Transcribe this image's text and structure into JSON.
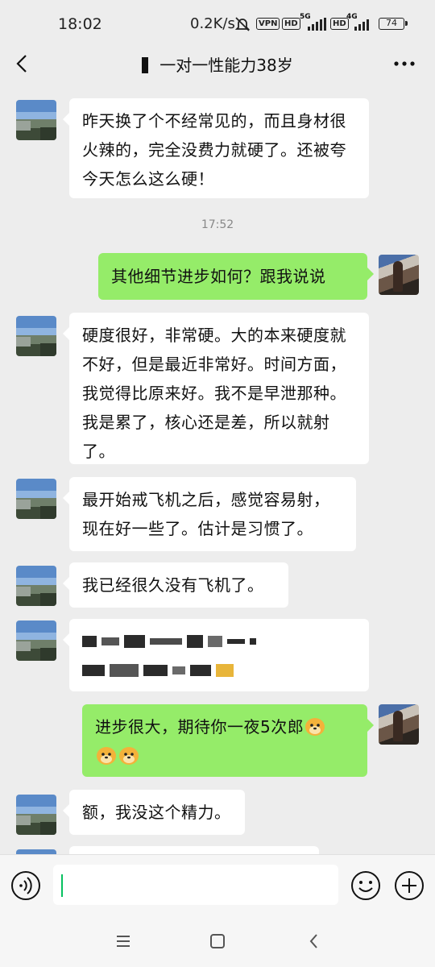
{
  "status_bar": {
    "time": "18:02",
    "net_speed": "0.2K/s",
    "vpn": "VPN",
    "hd1": "HD",
    "signal1": "5G",
    "hd2": "HD",
    "signal2": "4G",
    "battery": "74"
  },
  "header": {
    "title": "一对一性能力38岁"
  },
  "messages": [
    {
      "side": "left",
      "text": "昨天换了个不经常见的，而且身材很火辣的，完全没费力就硬了。还被夸今天怎么这么硬！"
    },
    {
      "type": "time",
      "text": "17:52"
    },
    {
      "side": "right",
      "text": "其他细节进步如何？跟我说说"
    },
    {
      "side": "left",
      "text": "硬度很好，非常硬。大的本来硬度就不好，但是最近非常好。时间方面，我觉得比原来好。我不是早泄那种。我是累了，核心还是差，所以就射了。"
    },
    {
      "side": "left",
      "text": "最开始戒飞机之后，感觉容易射，现在好一些了。估计是习惯了。"
    },
    {
      "side": "left",
      "text": "我已经很久没有飞机了。"
    },
    {
      "side": "left",
      "text": ""
    },
    {
      "side": "right",
      "text": "进步很大，期待你一夜5次郎",
      "emoji": "doge-emoji"
    },
    {
      "side": "left",
      "text": "额，我没这个精力。"
    }
  ],
  "input": {
    "placeholder": ""
  },
  "colors": {
    "background": "#ededed",
    "bubble_right": "#95ec69",
    "bubble_left": "#ffffff",
    "accent": "#07c160"
  }
}
